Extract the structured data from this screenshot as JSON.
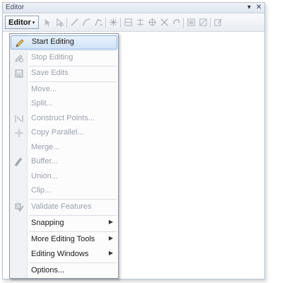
{
  "window": {
    "title": "Editor",
    "dropdown_glyph": "▾",
    "close_glyph": "✕"
  },
  "toolbar": {
    "editor_button_label": "Editor",
    "editor_caret": "▾",
    "tools": [
      "edit-tool-icon",
      "edit-annotation-icon",
      "straight-segment-icon",
      "arc-segment-icon",
      "segment-types-icon",
      "vertex-icon",
      "topology-icon",
      "split-icon",
      "rotate-icon",
      "cut-polygons-icon",
      "reshape-icon",
      "attributes-icon",
      "sketch-properties-icon",
      "create-features-icon"
    ]
  },
  "menu": {
    "items": [
      {
        "label": "Start Editing",
        "enabled": true,
        "highlighted": true,
        "icon": "pencil-icon"
      },
      {
        "label": "Stop Editing",
        "enabled": false,
        "icon": "stop-editing-icon"
      },
      {
        "label": "Save Edits",
        "enabled": false,
        "icon": "save-edits-icon"
      },
      {
        "label": "Move...",
        "enabled": false
      },
      {
        "label": "Split...",
        "enabled": false
      },
      {
        "label": "Construct Points...",
        "enabled": false,
        "icon": "construct-points-icon"
      },
      {
        "label": "Copy Parallel...",
        "enabled": false,
        "icon": "copy-parallel-icon"
      },
      {
        "label": "Merge...",
        "enabled": false
      },
      {
        "label": "Buffer...",
        "enabled": false,
        "icon": "buffer-icon"
      },
      {
        "label": "Union...",
        "enabled": false
      },
      {
        "label": "Clip...",
        "enabled": false
      },
      {
        "label": "Validate Features",
        "enabled": false,
        "icon": "validate-features-icon"
      },
      {
        "label": "Snapping",
        "enabled": true,
        "submenu": true
      },
      {
        "label": "More Editing Tools",
        "enabled": true,
        "submenu": true
      },
      {
        "label": "Editing Windows",
        "enabled": true,
        "submenu": true
      },
      {
        "label": "Options...",
        "enabled": true
      }
    ],
    "submenu_glyph": "▶"
  },
  "colors": {
    "highlight_fill": "#cfe2f8",
    "highlight_border": "#8eb4e4",
    "disabled_text": "#9aa1ab"
  }
}
